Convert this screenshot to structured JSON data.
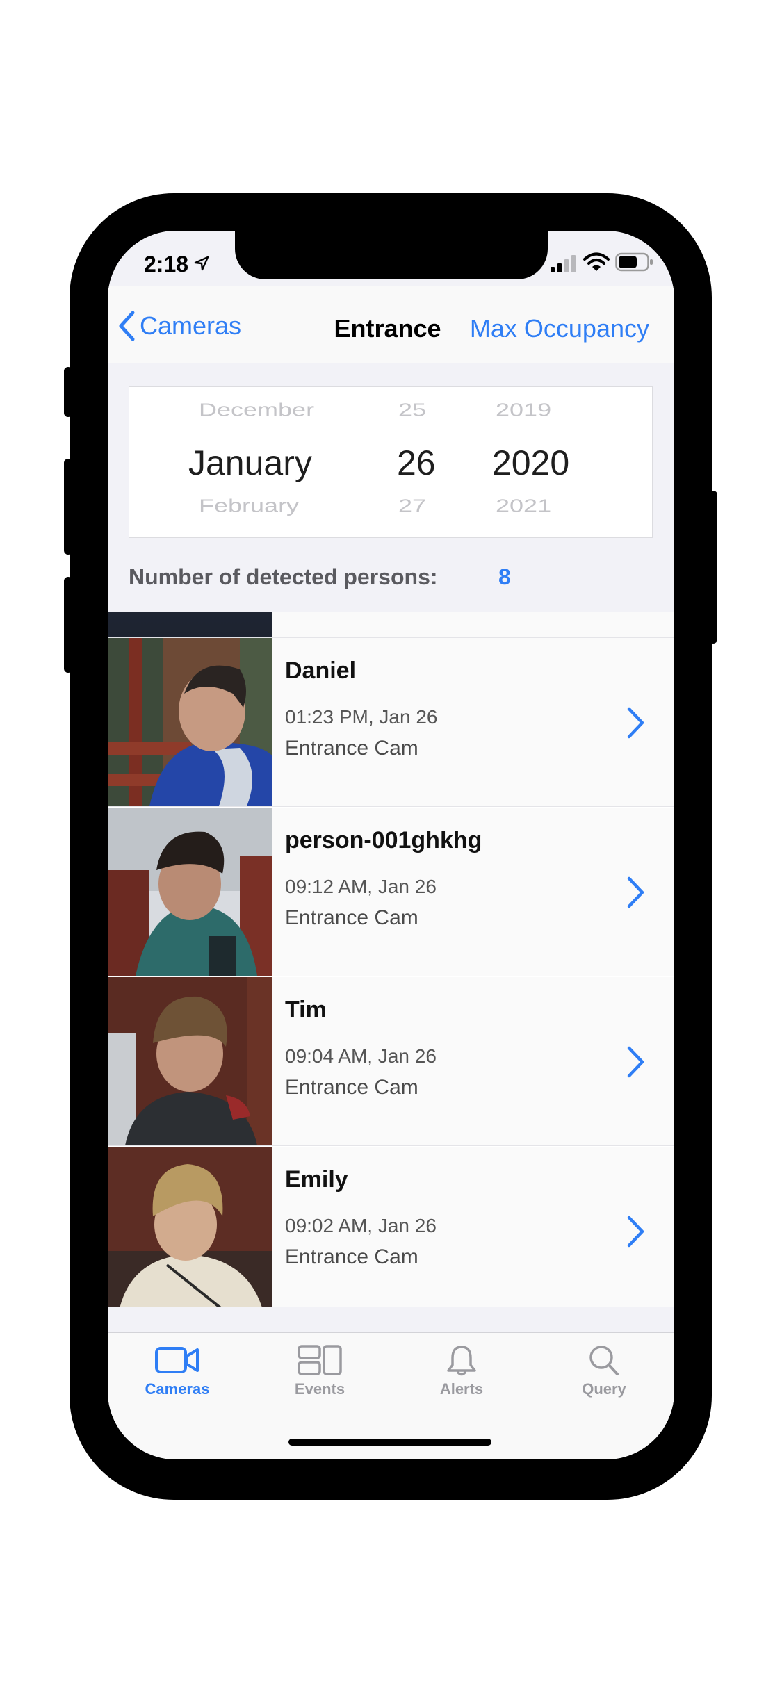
{
  "status_bar": {
    "time": "2:18"
  },
  "nav": {
    "back_label": "Cameras",
    "title": "Entrance",
    "right_action": "Max Occupancy"
  },
  "date_picker": {
    "month_prev": "December",
    "month": "January",
    "month_next": "February",
    "day_prev": "25",
    "day": "26",
    "day_next": "27",
    "year_prev": "2019",
    "year": "2020",
    "year_next": "2021"
  },
  "summary": {
    "label": "Number of detected persons:",
    "count": "8"
  },
  "persons": [
    {
      "name": "Daniel",
      "time": "01:23 PM, Jan 26",
      "camera": "Entrance Cam"
    },
    {
      "name": "person-001ghkhg",
      "time": "09:12 AM, Jan 26",
      "camera": "Entrance Cam"
    },
    {
      "name": "Tim",
      "time": "09:04 AM, Jan 26",
      "camera": "Entrance Cam"
    },
    {
      "name": "Emily",
      "time": "09:02 AM, Jan 26",
      "camera": "Entrance Cam"
    }
  ],
  "tabs": [
    {
      "label": "Cameras",
      "icon": "video-camera-icon"
    },
    {
      "label": "Events",
      "icon": "events-grid-icon"
    },
    {
      "label": "Alerts",
      "icon": "bell-icon"
    },
    {
      "label": "Query",
      "icon": "magnifier-icon"
    }
  ],
  "colors": {
    "accent": "#2f7ef5",
    "inactive": "#9a9a9f"
  }
}
